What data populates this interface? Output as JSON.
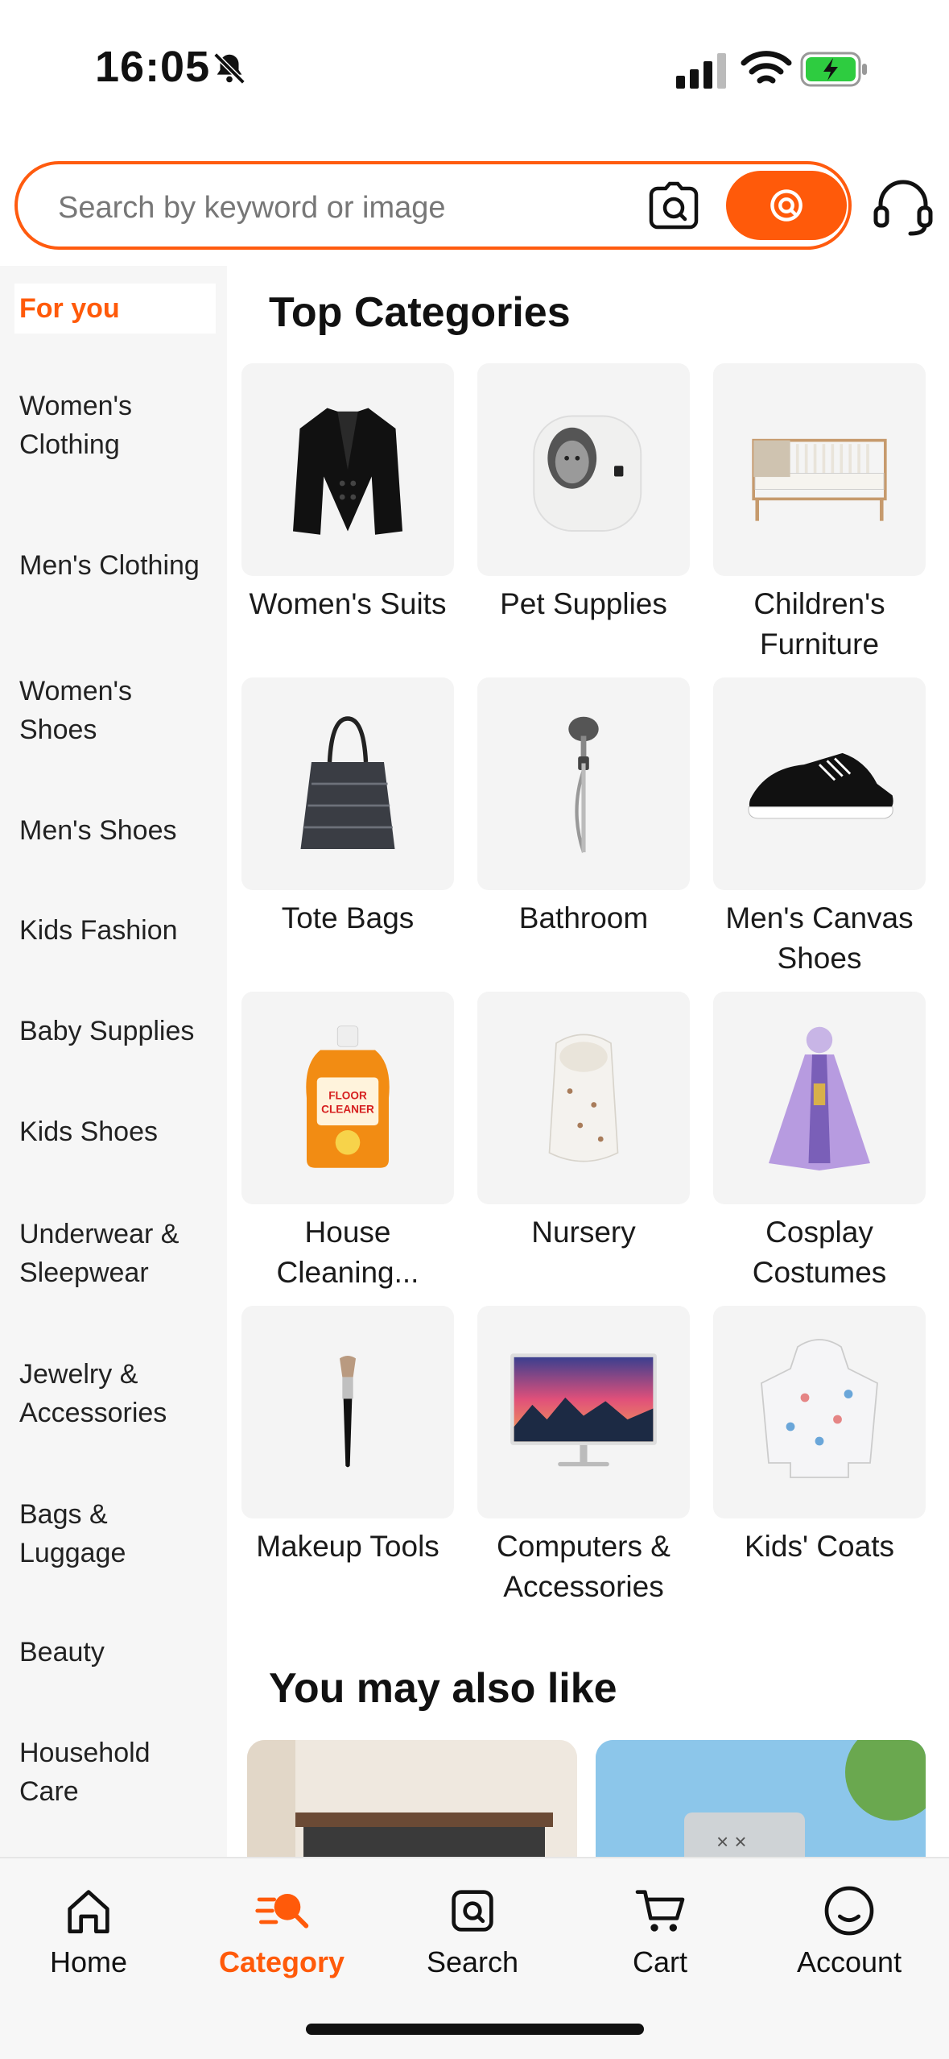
{
  "status_bar": {
    "time": "16:05"
  },
  "search": {
    "placeholder": "Search by keyword or image"
  },
  "sidebar": {
    "items": [
      {
        "label": "For you"
      },
      {
        "label": "Women's Clothing"
      },
      {
        "label": "Men's Clothing"
      },
      {
        "label": "Women's Shoes"
      },
      {
        "label": "Men's Shoes"
      },
      {
        "label": "Kids Fashion"
      },
      {
        "label": "Baby Supplies"
      },
      {
        "label": "Kids Shoes"
      },
      {
        "label": "Underwear & Sleepwear"
      },
      {
        "label": "Jewelry & Accessories"
      },
      {
        "label": "Bags & Luggage"
      },
      {
        "label": "Beauty"
      },
      {
        "label": "Household Care"
      }
    ]
  },
  "main": {
    "top_categories_title": "Top Categories",
    "categories": [
      {
        "label": "Women's Suits",
        "icon": "blazer-image"
      },
      {
        "label": "Pet Supplies",
        "icon": "cat-litter-box-image"
      },
      {
        "label": "Children's Furniture",
        "icon": "crib-image"
      },
      {
        "label": "Tote Bags",
        "icon": "tote-bag-image"
      },
      {
        "label": "Bathroom",
        "icon": "shower-head-image"
      },
      {
        "label": "Men's Canvas Shoes",
        "icon": "sneaker-image"
      },
      {
        "label": "House Cleaning...",
        "icon": "floor-cleaner-image"
      },
      {
        "label": "Nursery",
        "icon": "baby-sleepsack-image"
      },
      {
        "label": "Cosplay Costumes",
        "icon": "costume-image"
      },
      {
        "label": "Makeup Tools",
        "icon": "makeup-brush-image"
      },
      {
        "label": "Computers & Accessories",
        "icon": "monitor-image"
      },
      {
        "label": "Kids' Coats",
        "icon": "kids-coat-image"
      }
    ],
    "also_like_title": "You may also like"
  },
  "tabbar": {
    "tabs": [
      {
        "label": "Home",
        "icon": "home-icon"
      },
      {
        "label": "Category",
        "icon": "category-icon",
        "active": true
      },
      {
        "label": "Search",
        "icon": "search-icon"
      },
      {
        "label": "Cart",
        "icon": "cart-icon"
      },
      {
        "label": "Account",
        "icon": "account-icon"
      }
    ]
  },
  "colors": {
    "accent": "#ff5a0a",
    "sidebar_bg": "#f6f6f6",
    "tabbar_bg": "#f7f7f7"
  }
}
